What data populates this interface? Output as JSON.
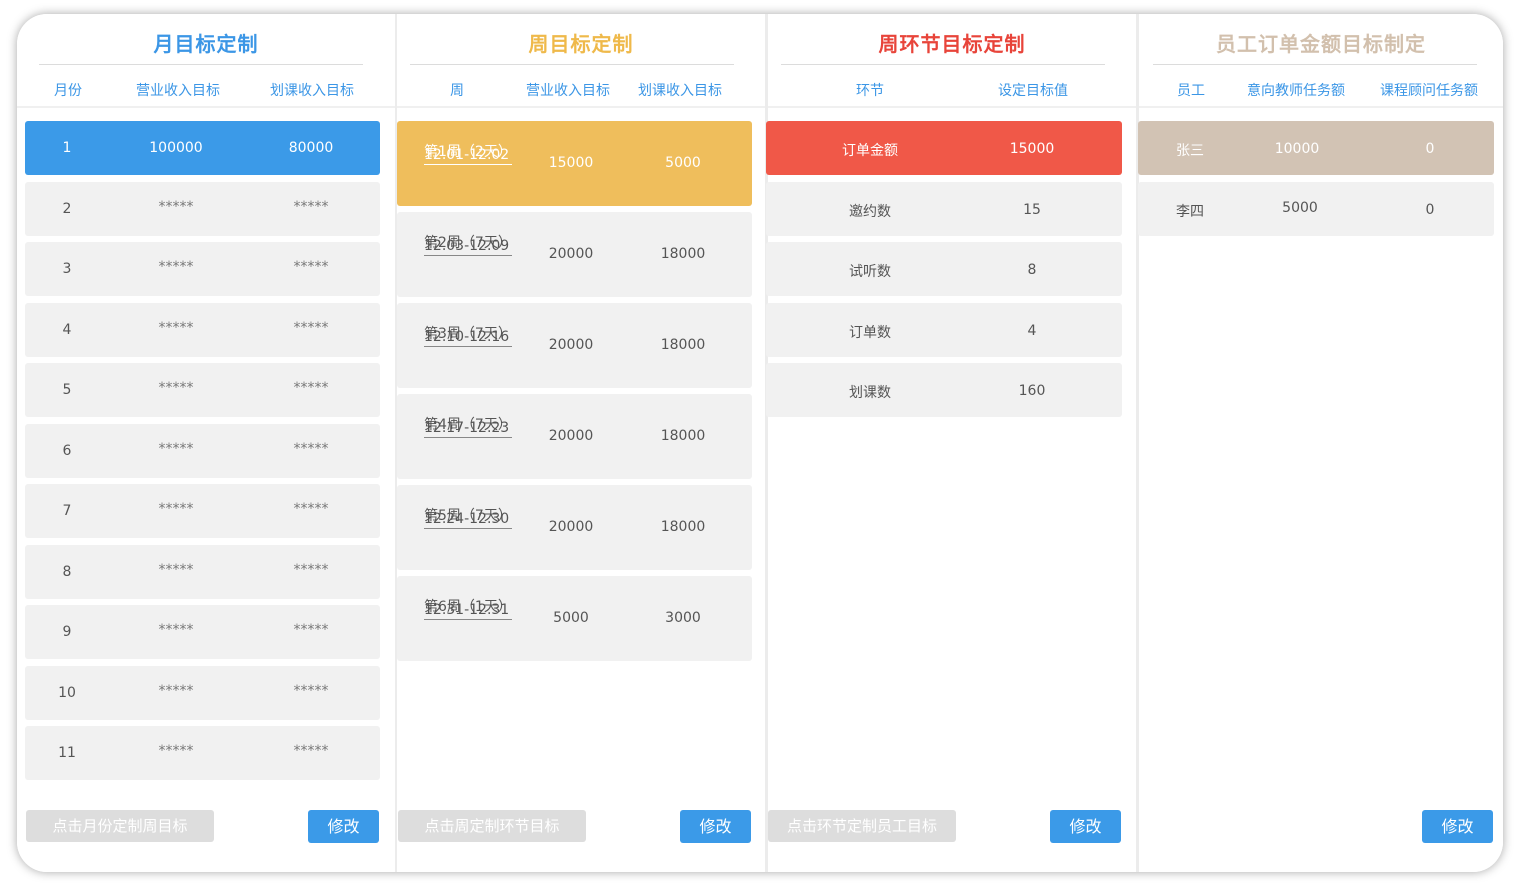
{
  "colors": {
    "blue": "#3b9ae8",
    "orange": "#efbe5c",
    "red": "#f05848",
    "tan": "#d2c3b4",
    "row_bg": "#f1f1f1"
  },
  "monthly": {
    "title": "月目标定制",
    "headers": [
      "月份",
      "营业收入目标",
      "划课收入目标"
    ],
    "rows": [
      {
        "month": "1",
        "revenue": "100000",
        "course": "80000"
      },
      {
        "month": "2",
        "revenue": "*****",
        "course": "*****"
      },
      {
        "month": "3",
        "revenue": "*****",
        "course": "*****"
      },
      {
        "month": "4",
        "revenue": "*****",
        "course": "*****"
      },
      {
        "month": "5",
        "revenue": "*****",
        "course": "*****"
      },
      {
        "month": "6",
        "revenue": "*****",
        "course": "*****"
      },
      {
        "month": "7",
        "revenue": "*****",
        "course": "*****"
      },
      {
        "month": "8",
        "revenue": "*****",
        "course": "*****"
      },
      {
        "month": "9",
        "revenue": "*****",
        "course": "*****"
      },
      {
        "month": "10",
        "revenue": "*****",
        "course": "*****"
      },
      {
        "month": "11",
        "revenue": "*****",
        "course": "*****"
      }
    ],
    "bottom_button": "点击月份定制周目标",
    "edit_button": "修改"
  },
  "weekly": {
    "title": "周目标定制",
    "headers": [
      "周",
      "营业收入目标",
      "划课收入目标"
    ],
    "rows": [
      {
        "week": "第1周（2天）",
        "range": "12.01-12.02",
        "revenue": "15000",
        "course": "5000"
      },
      {
        "week": "第2周（7天）",
        "range": "12.03-12.09",
        "revenue": "20000",
        "course": "18000"
      },
      {
        "week": "第3周（7天）",
        "range": "12.10-12.16",
        "revenue": "20000",
        "course": "18000"
      },
      {
        "week": "第4周（7天）",
        "range": "12.17-12.23",
        "revenue": "20000",
        "course": "18000"
      },
      {
        "week": "第5周（7天）",
        "range": "12.24-12.30",
        "revenue": "20000",
        "course": "18000"
      },
      {
        "week": "第6周（1天）",
        "range": "12.31-12.31",
        "revenue": "5000",
        "course": "3000"
      }
    ],
    "bottom_button": "点击周定制环节目标",
    "edit_button": "修改"
  },
  "stages": {
    "title": "周环节目标定制",
    "headers": [
      "环节",
      "设定目标值"
    ],
    "rows": [
      {
        "stage": "订单金额",
        "target": "15000"
      },
      {
        "stage": "邀约数",
        "target": "15"
      },
      {
        "stage": "试听数",
        "target": "8"
      },
      {
        "stage": "订单数",
        "target": "4"
      },
      {
        "stage": "划课数",
        "target": "160"
      }
    ],
    "bottom_button": "点击环节定制员工目标",
    "edit_button": "修改"
  },
  "staff": {
    "title": "员工订单金额目标制定",
    "headers": [
      "员工",
      "意向教师任务额",
      "课程顾问任务额"
    ],
    "rows": [
      {
        "name": "张三",
        "teacher": "10000",
        "advisor": "0"
      },
      {
        "name": "李四",
        "teacher": "5000",
        "advisor": "0"
      }
    ],
    "edit_button": "修改"
  }
}
